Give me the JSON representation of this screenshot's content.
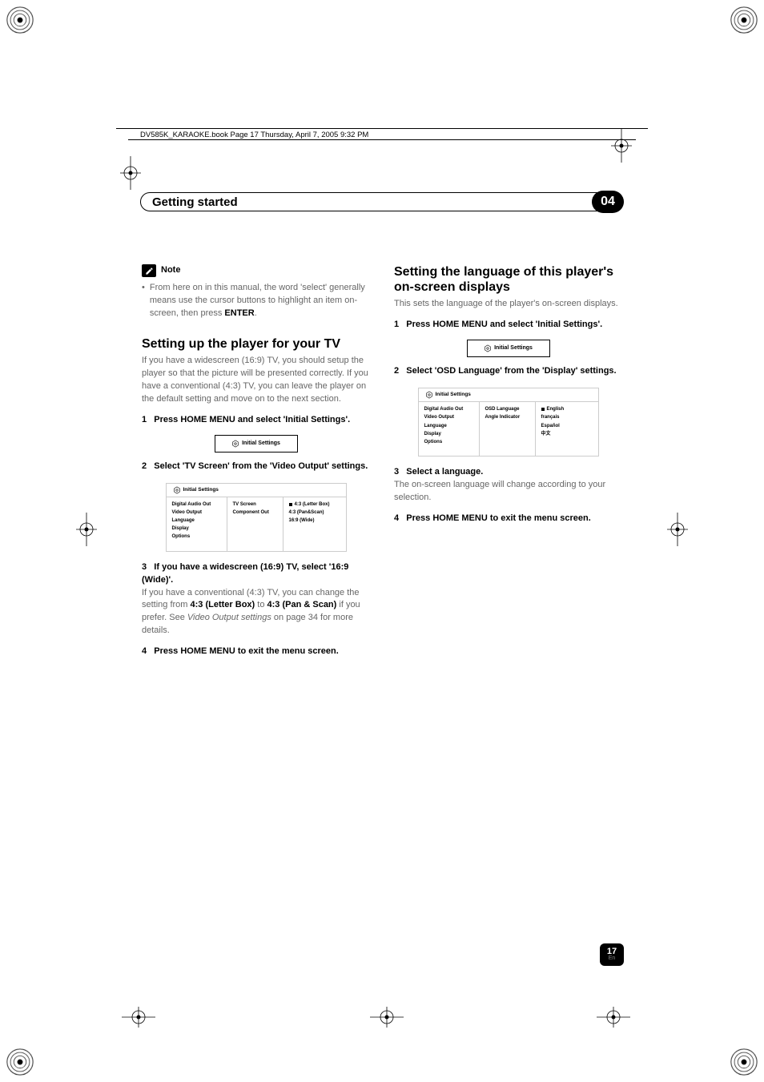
{
  "header": {
    "file_info": "DV585K_KARAOKE.book  Page 17  Thursday, April 7, 2005  9:32 PM"
  },
  "title_bar": {
    "label": "Getting started",
    "chapter": "04"
  },
  "note": {
    "label": "Note",
    "bullet_pre": "From here on in this manual, the word 'select' generally means use the cursor buttons to highlight an item on-screen, then press ",
    "bullet_bold": "ENTER",
    "bullet_post": "."
  },
  "sec1": {
    "heading": "Setting up the player for your TV",
    "intro": "If you have a widescreen (16:9) TV, you should setup the player so that the picture will be presented correctly. If you have a conventional (4:3) TV, you can leave the player on the default setting and move on to the next section.",
    "step1_num": "1",
    "step1": "Press HOME MENU and select 'Initial Settings'.",
    "step2_num": "2",
    "step2": "Select 'TV Screen' from the 'Video Output' settings.",
    "step3_num": "3",
    "step3": "If you have a widescreen (16:9) TV, select '16:9 (Wide)'.",
    "step3_body_pre": "If you have a conventional (4:3) TV, you can change the setting from ",
    "step3_bold1": "4:3 (Letter Box)",
    "step3_mid": " to ",
    "step3_bold2": "4:3 (Pan & Scan)",
    "step3_post1": " if you prefer. See ",
    "step3_italic": "Video Output settings",
    "step3_post2": " on page 34 for more details.",
    "step4_num": "4",
    "step4": "Press HOME MENU to exit the menu screen."
  },
  "sec2": {
    "heading": "Setting the language of this player's on-screen displays",
    "intro": "This sets the language of the player's on-screen displays.",
    "step1_num": "1",
    "step1": "Press HOME MENU and select 'Initial Settings'.",
    "step2_num": "2",
    "step2": "Select 'OSD Language' from the 'Display' settings.",
    "step3_num": "3",
    "step3": "Select a language.",
    "step3_body": "The on-screen language will change according to your selection.",
    "step4_num": "4",
    "step4": "Press HOME MENU to exit the menu screen."
  },
  "menu": {
    "initial": "Initial Settings",
    "col1": {
      "a": "Digital Audio Out",
      "b": "Video Output",
      "c": "Language",
      "d": "Display",
      "e": "Options"
    },
    "video_col2": {
      "a": "TV Screen",
      "b": "Component Out"
    },
    "video_col3": {
      "a": "4:3 (Letter Box)",
      "b": "4:3 (Pan&Scan)",
      "c": "16:9 (Wide)"
    },
    "disp_col2": {
      "a": "OSD Language",
      "b": "Angle Indicator"
    },
    "disp_col3": {
      "a": "English",
      "b": "français",
      "c": "Español",
      "d": "中文"
    }
  },
  "page": {
    "num": "17",
    "lang": "En"
  }
}
